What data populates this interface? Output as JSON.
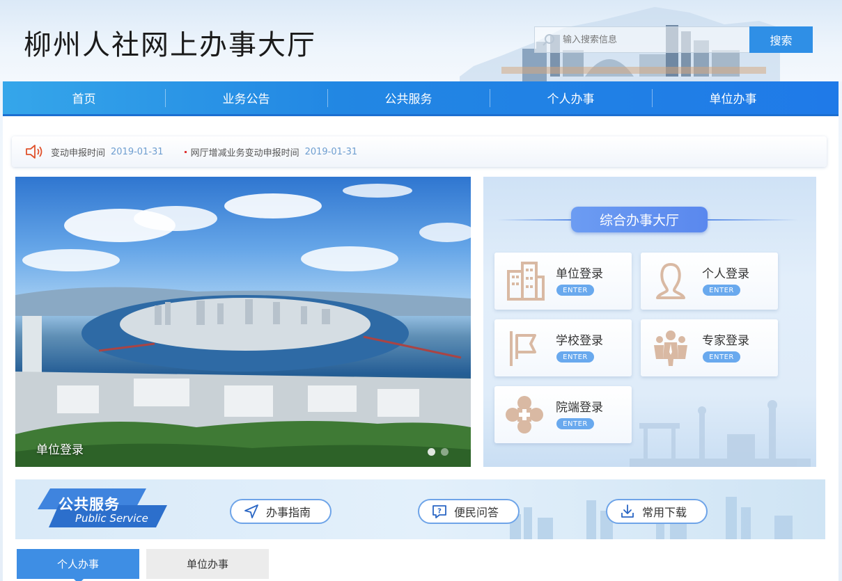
{
  "header": {
    "title": "柳州人社网上办事大厅",
    "search": {
      "placeholder": "输入搜索信息",
      "button_label": "搜索"
    }
  },
  "nav": {
    "items": [
      {
        "label": "首页"
      },
      {
        "label": "业务公告"
      },
      {
        "label": "公共服务"
      },
      {
        "label": "个人办事"
      },
      {
        "label": "单位办事"
      }
    ]
  },
  "notices": [
    {
      "text": "变动申报时间",
      "date": "2019-01-31"
    },
    {
      "text": "网厅增减业务变动申报时间",
      "date": "2019-01-31"
    }
  ],
  "banner": {
    "caption": "单位登录",
    "slide_count": 2,
    "active_slide": 1
  },
  "hall": {
    "title": "综合办事大厅",
    "enter_label": "ENTER",
    "cards": [
      {
        "label": "单位登录",
        "icon": "building-icon"
      },
      {
        "label": "个人登录",
        "icon": "person-icon"
      },
      {
        "label": "学校登录",
        "icon": "flag-icon"
      },
      {
        "label": "专家登录",
        "icon": "group-icon"
      },
      {
        "label": "院端登录",
        "icon": "medical-cross-icon"
      }
    ]
  },
  "public_service": {
    "title_cn": "公共服务",
    "title_en": "Public Service",
    "buttons": [
      {
        "label": "办事指南",
        "icon": "navigation-arrow-icon"
      },
      {
        "label": "便民问答",
        "icon": "question-bubble-icon"
      },
      {
        "label": "常用下载",
        "icon": "download-icon"
      }
    ]
  },
  "tabs": [
    {
      "label": "个人办事",
      "active": true
    },
    {
      "label": "单位办事",
      "active": false
    }
  ],
  "colors": {
    "nav_blue": "#2287e3",
    "accent_blue": "#2f8fe6",
    "icon_tan": "#d9b9a3",
    "enter_badge": "#69a9ee"
  }
}
